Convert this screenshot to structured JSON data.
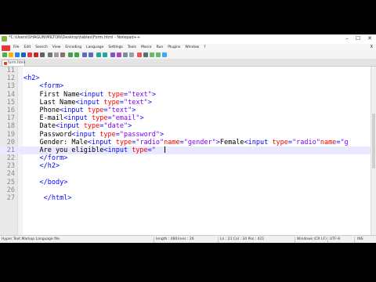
{
  "window": {
    "title": "*C:\\Users\\SHAGUN\\MILTON\\Desktop\\tables\\Form.html - Notepad++",
    "minimize": "–",
    "maximize": "☐",
    "close": "✕"
  },
  "menu": {
    "items": [
      "File",
      "Edit",
      "Search",
      "View",
      "Encoding",
      "Language",
      "Settings",
      "Tools",
      "Macro",
      "Run",
      "Plugins",
      "Window",
      "?"
    ],
    "close": "X"
  },
  "tab": {
    "label": "form.html"
  },
  "editor": {
    "lines": [
      {
        "num": "11",
        "html": ""
      },
      {
        "num": "12",
        "html": "<span class=\"tag\">&lt;h2&gt;</span>"
      },
      {
        "num": "13",
        "html": "    <span class=\"tag\">&lt;form&gt;</span>"
      },
      {
        "num": "14",
        "html": "    First Name<span class=\"tag\">&lt;input </span><span class=\"attr\">type</span><span class=\"tag\">=</span><span class=\"val\">\"text\"</span><span class=\"tag\">&gt;</span>"
      },
      {
        "num": "15",
        "html": "    Last Name<span class=\"tag\">&lt;input </span><span class=\"attr\">type</span><span class=\"tag\">=</span><span class=\"val\">\"text\"</span><span class=\"tag\">&gt;</span>"
      },
      {
        "num": "16",
        "html": "    Phone<span class=\"tag\">&lt;input </span><span class=\"attr\">type</span><span class=\"tag\">=</span><span class=\"val\">\"text\"</span><span class=\"tag\">&gt;</span>"
      },
      {
        "num": "17",
        "html": "    E-mail<span class=\"tag\">&lt;input </span><span class=\"attr\">type</span><span class=\"tag\">=</span><span class=\"val\">\"email\"</span><span class=\"tag\">&gt;</span>"
      },
      {
        "num": "18",
        "html": "    Date<span class=\"tag\">&lt;input </span><span class=\"attr\">type</span><span class=\"tag\">=</span><span class=\"val\">\"date\"</span><span class=\"tag\">&gt;</span>"
      },
      {
        "num": "19",
        "html": "    Password<span class=\"tag\">&lt;input </span><span class=\"attr\">type</span><span class=\"tag\">=</span><span class=\"val\">\"password\"</span><span class=\"tag\">&gt;</span>"
      },
      {
        "num": "20",
        "html": "    Gender: Male<span class=\"tag\">&lt;input </span><span class=\"attr\">type</span><span class=\"tag\">=</span><span class=\"val\">\"radio\"</span><span class=\"attr\">name</span><span class=\"tag\">=</span><span class=\"val\">\"gender\"</span><span class=\"tag\">&gt;</span>Female<span class=\"tag\">&lt;input </span><span class=\"attr\">type</span><span class=\"tag\">=</span><span class=\"val\">\"radio\"</span><span class=\"attr\">name</span><span class=\"tag\">=</span><span class=\"val\">\"g</span>"
      },
      {
        "num": "21",
        "html": "    Are you eligible<span class=\"tag\">&lt;input </span><span class=\"attr\">type</span><span class=\"tag\">=</span><span class=\"val\">\" </span>",
        "current": true
      },
      {
        "num": "22",
        "html": "    <span class=\"tag\">&lt;/form&gt;</span>"
      },
      {
        "num": "23",
        "html": "    <span class=\"tag\">&lt;/h2&gt;</span>"
      },
      {
        "num": "24",
        "html": ""
      },
      {
        "num": "25",
        "html": "    <span class=\"tag\">&lt;/body&gt;</span>"
      },
      {
        "num": "26",
        "html": ""
      },
      {
        "num": "27",
        "html": "     <span class=\"tag\">&lt;/html&gt;</span>"
      },
      {
        "num": "",
        "html": ""
      },
      {
        "num": "",
        "html": ""
      }
    ]
  },
  "status": {
    "filetype": "Hyper Text Markup Language file",
    "length": "length : 480",
    "lines": "lines : 26",
    "position": "Ln : 21   Col : 34   Pos : 421",
    "eol": "Windows (CR LF)",
    "encoding": "UTF-8",
    "mode": "INS"
  }
}
